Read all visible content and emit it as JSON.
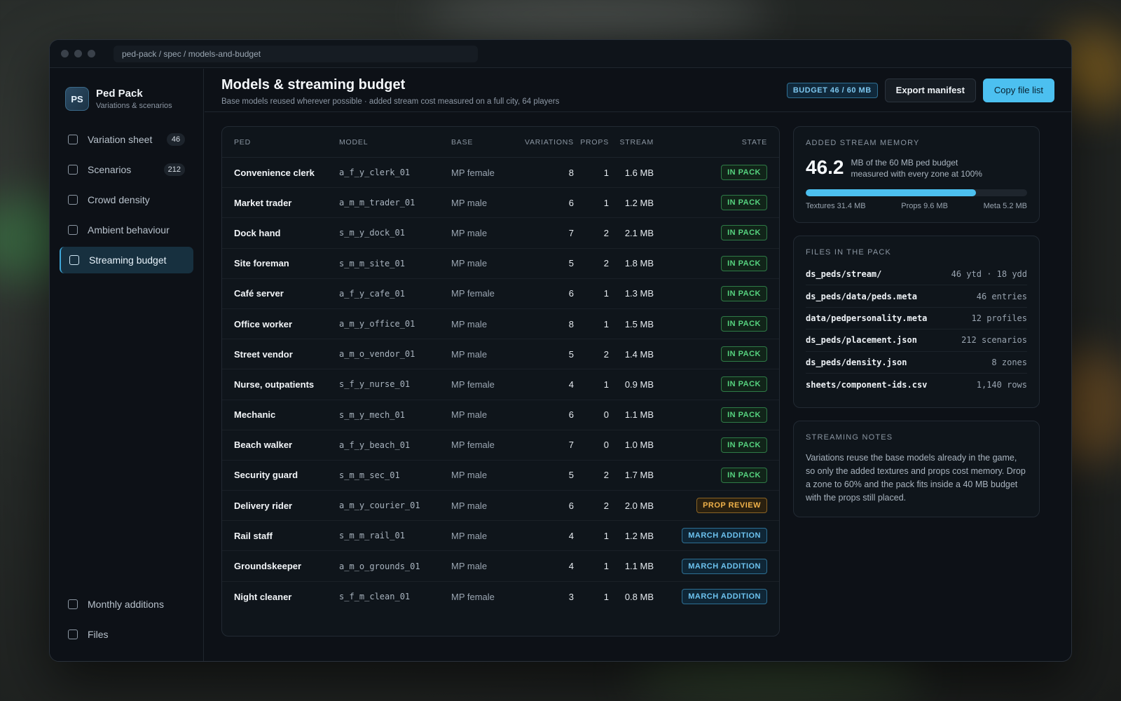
{
  "window": {
    "url": "ped-pack / spec / models-and-budget"
  },
  "brand": {
    "logo": "PS",
    "name": "Ped Pack",
    "subtitle": "Variations & scenarios"
  },
  "sidebar": {
    "items": [
      {
        "label": "Variation sheet",
        "badge": "46"
      },
      {
        "label": "Scenarios",
        "badge": "212"
      },
      {
        "label": "Crowd density",
        "badge": ""
      },
      {
        "label": "Ambient behaviour",
        "badge": ""
      },
      {
        "label": "Streaming budget",
        "badge": "",
        "active": true
      }
    ],
    "bottom_items": [
      {
        "label": "Monthly additions"
      },
      {
        "label": "Files"
      }
    ]
  },
  "header": {
    "title": "Models & streaming budget",
    "subtitle": "Base models reused wherever possible · added stream cost measured on a full city, 64 players",
    "budget_badge": "BUDGET 46 / 60 MB",
    "export_label": "Export manifest",
    "copy_label": "Copy file list"
  },
  "table": {
    "columns": {
      "ped": "PED",
      "model": "MODEL",
      "base": "BASE",
      "variations": "VARIATIONS",
      "props": "PROPS",
      "stream": "STREAM",
      "state": "STATE"
    },
    "rows": [
      {
        "ped": "Convenience clerk",
        "model": "a_f_y_clerk_01",
        "base": "MP female",
        "variations": "8",
        "props": "1",
        "stream": "1.6 MB",
        "state": "IN PACK",
        "state_kind": "in"
      },
      {
        "ped": "Market trader",
        "model": "a_m_m_trader_01",
        "base": "MP male",
        "variations": "6",
        "props": "1",
        "stream": "1.2 MB",
        "state": "IN PACK",
        "state_kind": "in"
      },
      {
        "ped": "Dock hand",
        "model": "s_m_y_dock_01",
        "base": "MP male",
        "variations": "7",
        "props": "2",
        "stream": "2.1 MB",
        "state": "IN PACK",
        "state_kind": "in"
      },
      {
        "ped": "Site foreman",
        "model": "s_m_m_site_01",
        "base": "MP male",
        "variations": "5",
        "props": "2",
        "stream": "1.8 MB",
        "state": "IN PACK",
        "state_kind": "in"
      },
      {
        "ped": "Café server",
        "model": "a_f_y_cafe_01",
        "base": "MP female",
        "variations": "6",
        "props": "1",
        "stream": "1.3 MB",
        "state": "IN PACK",
        "state_kind": "in"
      },
      {
        "ped": "Office worker",
        "model": "a_m_y_office_01",
        "base": "MP male",
        "variations": "8",
        "props": "1",
        "stream": "1.5 MB",
        "state": "IN PACK",
        "state_kind": "in"
      },
      {
        "ped": "Street vendor",
        "model": "a_m_o_vendor_01",
        "base": "MP male",
        "variations": "5",
        "props": "2",
        "stream": "1.4 MB",
        "state": "IN PACK",
        "state_kind": "in"
      },
      {
        "ped": "Nurse, outpatients",
        "model": "s_f_y_nurse_01",
        "base": "MP female",
        "variations": "4",
        "props": "1",
        "stream": "0.9 MB",
        "state": "IN PACK",
        "state_kind": "in"
      },
      {
        "ped": "Mechanic",
        "model": "s_m_y_mech_01",
        "base": "MP male",
        "variations": "6",
        "props": "0",
        "stream": "1.1 MB",
        "state": "IN PACK",
        "state_kind": "in"
      },
      {
        "ped": "Beach walker",
        "model": "a_f_y_beach_01",
        "base": "MP female",
        "variations": "7",
        "props": "0",
        "stream": "1.0 MB",
        "state": "IN PACK",
        "state_kind": "in"
      },
      {
        "ped": "Security guard",
        "model": "s_m_m_sec_01",
        "base": "MP male",
        "variations": "5",
        "props": "2",
        "stream": "1.7 MB",
        "state": "IN PACK",
        "state_kind": "in"
      },
      {
        "ped": "Delivery rider",
        "model": "a_m_y_courier_01",
        "base": "MP male",
        "variations": "6",
        "props": "2",
        "stream": "2.0 MB",
        "state": "PROP REVIEW",
        "state_kind": "review"
      },
      {
        "ped": "Rail staff",
        "model": "s_m_m_rail_01",
        "base": "MP male",
        "variations": "4",
        "props": "1",
        "stream": "1.2 MB",
        "state": "MARCH ADDITION",
        "state_kind": "march"
      },
      {
        "ped": "Groundskeeper",
        "model": "a_m_o_grounds_01",
        "base": "MP male",
        "variations": "4",
        "props": "1",
        "stream": "1.1 MB",
        "state": "MARCH ADDITION",
        "state_kind": "march"
      },
      {
        "ped": "Night cleaner",
        "model": "s_f_m_clean_01",
        "base": "MP female",
        "variations": "3",
        "props": "1",
        "stream": "0.8 MB",
        "state": "MARCH ADDITION",
        "state_kind": "march"
      }
    ]
  },
  "memory": {
    "label": "ADDED STREAM MEMORY",
    "value": "46.2",
    "desc_line1": "MB of the 60 MB ped budget",
    "desc_line2": "measured with every zone at 100%",
    "fill_fraction": 0.77,
    "textures": "Textures 31.4 MB",
    "props": "Props 9.6 MB",
    "meta": "Meta 5.2 MB"
  },
  "files": {
    "label": "FILES IN THE PACK",
    "items": [
      {
        "name": "ds_peds/stream/",
        "meta": "46 ytd · 18 ydd"
      },
      {
        "name": "ds_peds/data/peds.meta",
        "meta": "46 entries"
      },
      {
        "name": "data/pedpersonality.meta",
        "meta": "12 profiles"
      },
      {
        "name": "ds_peds/placement.json",
        "meta": "212 scenarios"
      },
      {
        "name": "ds_peds/density.json",
        "meta": "8 zones"
      },
      {
        "name": "sheets/component-ids.csv",
        "meta": "1,140 rows"
      }
    ]
  },
  "notes": {
    "label": "STREAMING NOTES",
    "text": "Variations reuse the base models already in the game, so only the added textures and props cost memory. Drop a zone to 60% and the pack fits inside a 40 MB budget with the props still placed."
  },
  "colors": {
    "accent": "#4cc0f0",
    "in_pack": "#56d37f",
    "review": "#f1b24a",
    "march": "#6cc2ef"
  }
}
